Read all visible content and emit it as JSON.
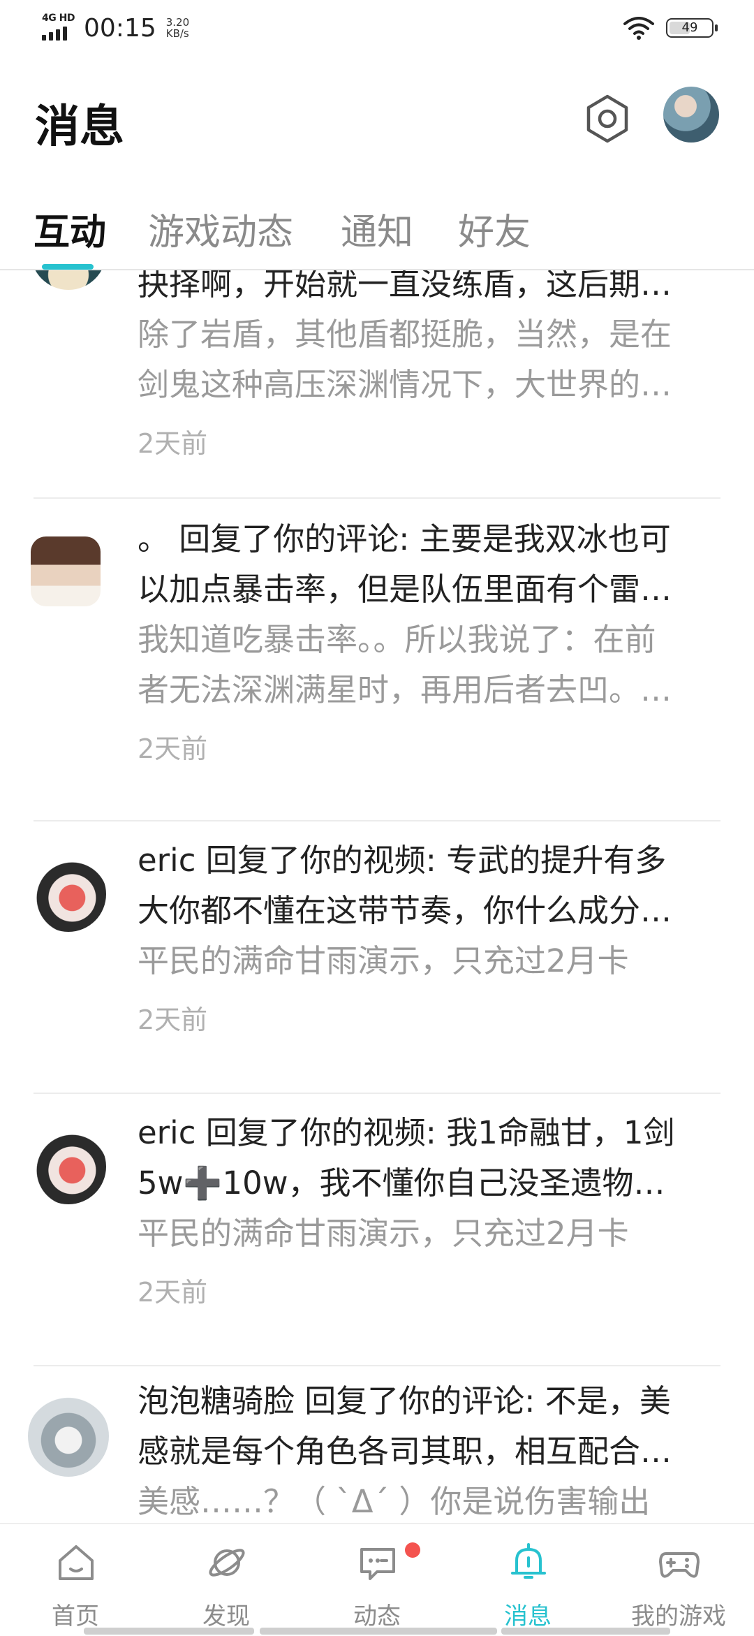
{
  "status_bar": {
    "network": "4G HD",
    "time": "00:15",
    "speed_value": "3.20",
    "speed_unit": "KB/s",
    "battery": "49"
  },
  "header": {
    "title": "消息"
  },
  "tabs": [
    {
      "label": "互动",
      "active": true
    },
    {
      "label": "游戏动态",
      "active": false
    },
    {
      "label": "通知",
      "active": false
    },
    {
      "label": "好友",
      "active": false
    }
  ],
  "messages": [
    {
      "lines": [
        "抉择啊，开始就一直没练盾，这后期…"
      ],
      "quote": [
        "除了岩盾，其他盾都挺脆，当然，是在",
        "剑鬼这种高压深渊情况下，大世界的…"
      ],
      "time": "2天前"
    },
    {
      "lines": [
        "。 回复了你的评论: 主要是我双冰也可",
        "以加点暴击率，但是队伍里面有个雷…"
      ],
      "quote": [
        "我知道吃暴击率。。所以我说了：在前",
        "者无法深渊满星时，再用后者去凹。…"
      ],
      "time": "2天前"
    },
    {
      "lines": [
        "eric 回复了你的视频: 专武的提升有多",
        "大你都不懂在这带节奏，你什么成分…"
      ],
      "quote": [
        "平民的满命甘雨演示，只充过2月卡"
      ],
      "time": "2天前"
    },
    {
      "lines": [
        "eric 回复了你的视频: 我1命融甘，1剑",
        "5w➕10w，我不懂你自己没圣遗物…"
      ],
      "quote": [
        "平民的满命甘雨演示，只充过2月卡"
      ],
      "time": "2天前"
    },
    {
      "lines": [
        "泡泡糖骑脸 回复了你的评论: 不是，美",
        "感就是每个角色各司其职，相互配合…"
      ],
      "quote": [
        "美感……？（ ˋ̀Δˊ́ ）你是说伤害输出"
      ],
      "time": ""
    }
  ],
  "bottom_nav": [
    {
      "label": "首页",
      "icon": "home-icon",
      "active": false
    },
    {
      "label": "发现",
      "icon": "planet-icon",
      "active": false
    },
    {
      "label": "动态",
      "icon": "chat-bubble-icon",
      "active": false
    },
    {
      "label": "消息",
      "icon": "bell-icon",
      "active": true
    },
    {
      "label": "我的游戏",
      "icon": "gamepad-icon",
      "active": false
    }
  ],
  "colors": {
    "accent": "#27c2cf",
    "badge": "#f4534f"
  }
}
